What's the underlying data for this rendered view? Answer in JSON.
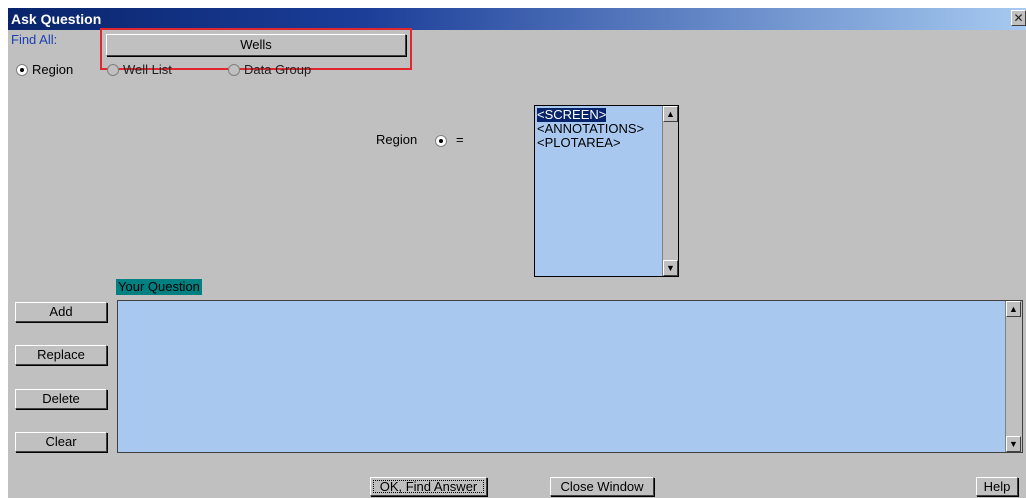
{
  "window": {
    "title": "Ask Question",
    "close_glyph": "✕"
  },
  "find_all": {
    "label": "Find All:",
    "button_label": "Wells"
  },
  "search_by": {
    "options": [
      {
        "label": "Region",
        "checked": true
      },
      {
        "label": "Well List",
        "checked": false
      },
      {
        "label": "Data Group",
        "checked": false
      }
    ]
  },
  "region_selector": {
    "label": "Region",
    "equals": "="
  },
  "region_list": {
    "items": [
      "<SCREEN>",
      "<ANNOTATIONS>",
      "<PLOTAREA>"
    ],
    "selected_index": 0
  },
  "question": {
    "label": "Your Question",
    "text": ""
  },
  "actions": {
    "add": "Add",
    "replace": "Replace",
    "delete": "Delete",
    "clear": "Clear"
  },
  "footer": {
    "ok": "OK, Find Answer",
    "close": "Close Window",
    "help": "Help"
  },
  "colors": {
    "titlebar": "#08246b",
    "dialog_bg": "#c0c0c0",
    "field_bg": "#a8c8f0",
    "label_teal": "#008080",
    "highlight": "#e0262e"
  }
}
